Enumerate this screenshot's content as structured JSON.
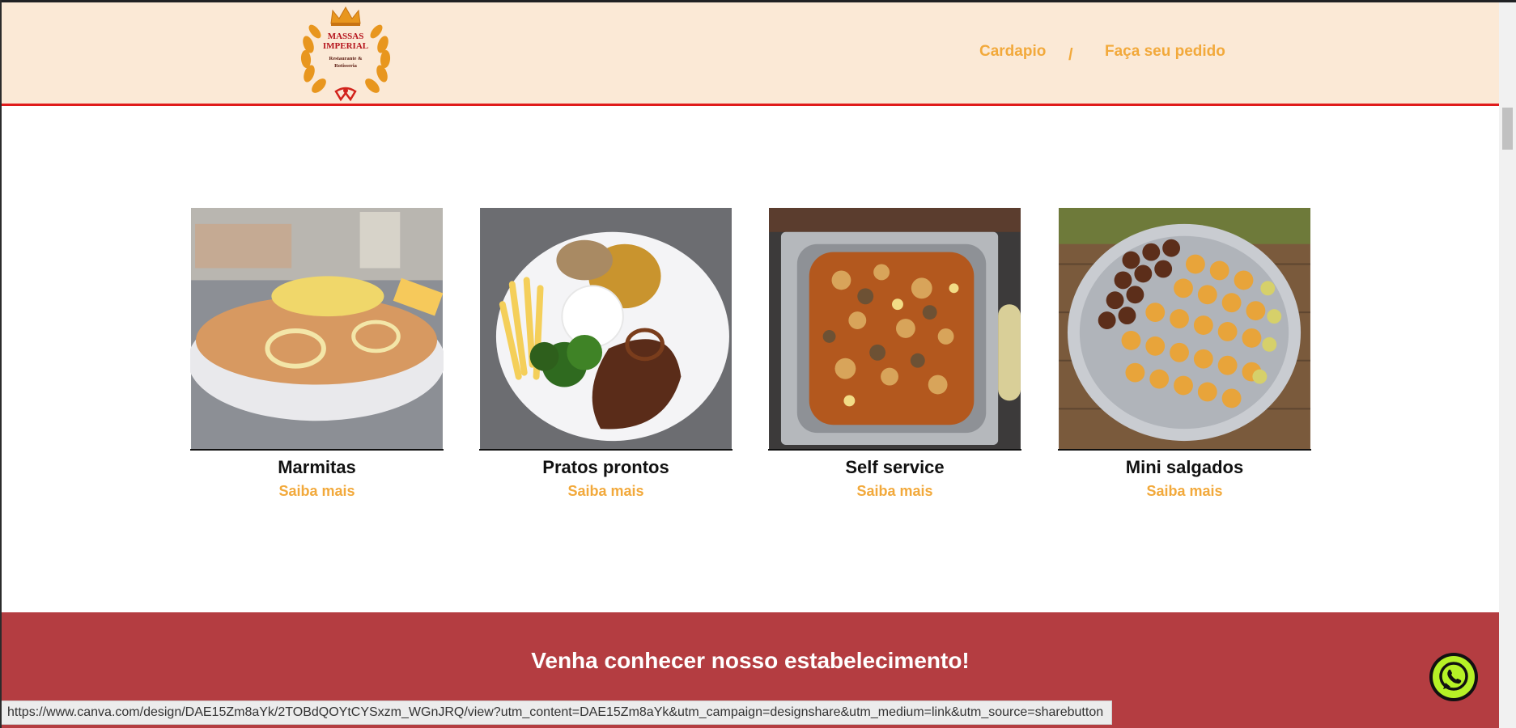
{
  "header": {
    "logo": {
      "line1": "MASSAS",
      "line2": "IMPERIAL",
      "line3": "Restaurante &",
      "line4": "Rotisseria",
      "icon": "crown-laurel-logo"
    },
    "nav": {
      "menu": "Cardapio",
      "separator": "/",
      "order": "Faça seu pedido"
    }
  },
  "cards": [
    {
      "title": "Marmitas",
      "link": "Saiba mais"
    },
    {
      "title": "Pratos prontos",
      "link": "Saiba mais"
    },
    {
      "title": "Self service",
      "link": "Saiba mais"
    },
    {
      "title": "Mini salgados",
      "link": "Saiba mais"
    }
  ],
  "banner": {
    "title": "Venha conhecer nosso estabelecimento!"
  },
  "whatsapp": {
    "icon": "whatsapp-icon"
  },
  "statusbar": {
    "url": "https://www.canva.com/design/DAE15Zm8aYk/2TOBdQOYtCYSxzm_WGnJRQ/view?utm_content=DAE15Zm8aYk&utm_campaign=designshare&utm_medium=link&utm_source=sharebutton"
  },
  "colors": {
    "accent": "#f2a93b",
    "header_bg": "#fbe9d6",
    "header_border": "#e01b1b",
    "banner_bg": "#b43d41",
    "whatsapp_green": "#25d366"
  }
}
